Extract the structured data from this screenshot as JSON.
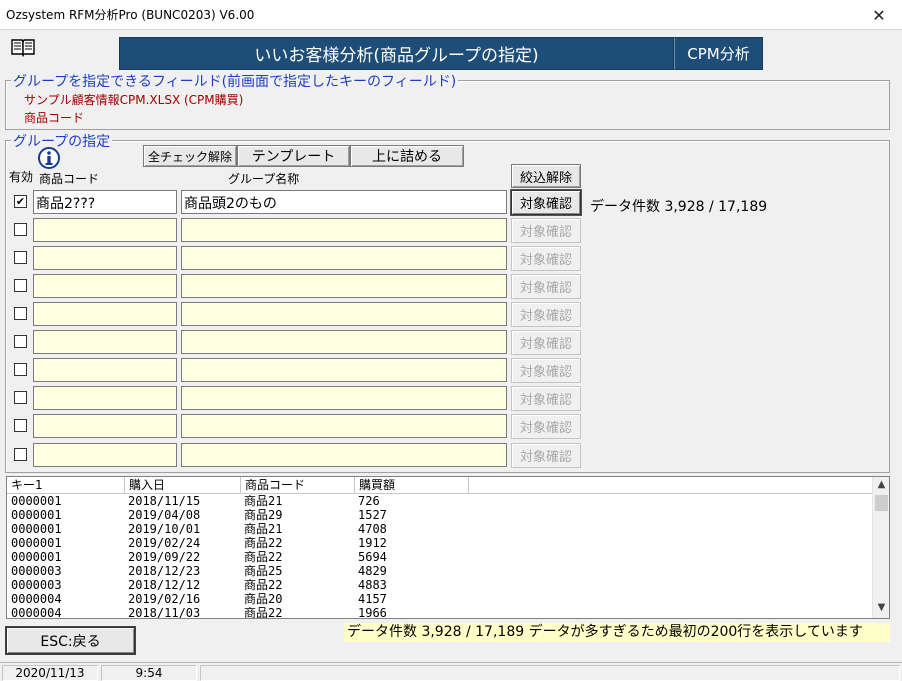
{
  "window": {
    "title": "Ozsystem RFM分析Pro (BUNC0203)   V6.00",
    "close_glyph": "✕"
  },
  "header": {
    "banner": "いいお客様分析(商品グループの指定)",
    "cpm_button": "CPM分析"
  },
  "field_group": {
    "legend": "グループを指定できるフィールド(前画面で指定したキーのフィールド)",
    "source": "サンプル顧客情報CPM.XLSX (CPM購買)",
    "field": "商品コード"
  },
  "group_spec": {
    "legend": "グループの指定",
    "buttons": {
      "uncheck_all": "全チェック解除",
      "template": "テンプレート",
      "compact": "上に詰める",
      "clear_filter": "絞込解除"
    },
    "columns": {
      "enabled": "有効",
      "code": "商品コード",
      "name": "グループ名称"
    },
    "confirm_label": "対象確認",
    "rows": [
      {
        "checked": "✔",
        "code": "商品2???",
        "name": "商品頭2のもの"
      },
      {
        "checked": "",
        "code": "",
        "name": ""
      },
      {
        "checked": "",
        "code": "",
        "name": ""
      },
      {
        "checked": "",
        "code": "",
        "name": ""
      },
      {
        "checked": "",
        "code": "",
        "name": ""
      },
      {
        "checked": "",
        "code": "",
        "name": ""
      },
      {
        "checked": "",
        "code": "",
        "name": ""
      },
      {
        "checked": "",
        "code": "",
        "name": ""
      },
      {
        "checked": "",
        "code": "",
        "name": ""
      },
      {
        "checked": "",
        "code": "",
        "name": ""
      }
    ],
    "data_count": "データ件数 3,928 / 17,189"
  },
  "listview": {
    "headers": [
      "キー1",
      "購入日",
      "商品コード",
      "購買額"
    ],
    "rows": [
      [
        "0000001",
        "2018/11/15",
        "商品21",
        "726"
      ],
      [
        "0000001",
        "2019/04/08",
        "商品29",
        "1527"
      ],
      [
        "0000001",
        "2019/10/01",
        "商品21",
        "4708"
      ],
      [
        "0000001",
        "2019/02/24",
        "商品22",
        "1912"
      ],
      [
        "0000001",
        "2019/09/22",
        "商品22",
        "5694"
      ],
      [
        "0000003",
        "2018/12/23",
        "商品25",
        "4829"
      ],
      [
        "0000003",
        "2018/12/12",
        "商品22",
        "4883"
      ],
      [
        "0000004",
        "2019/02/16",
        "商品20",
        "4157"
      ],
      [
        "0000004",
        "2018/11/03",
        "商品22",
        "1966"
      ]
    ],
    "scroll_up": "▲",
    "scroll_down": "▼"
  },
  "footer": {
    "esc_button": "ESC:戻る",
    "message": "データ件数 3,928 / 17,189 データが多すぎるため最初の200行を表示しています"
  },
  "statusbar": {
    "date": "2020/11/13",
    "time": "9:54"
  }
}
